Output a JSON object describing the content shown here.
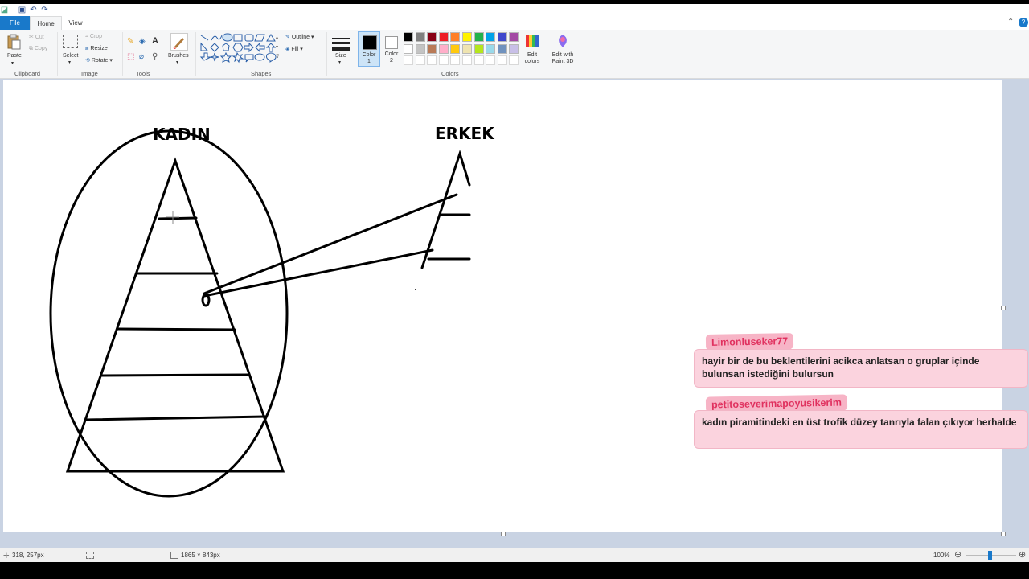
{
  "tabs": {
    "file": "File",
    "home": "Home",
    "view": "View"
  },
  "ribbon": {
    "clipboard": {
      "paste": "Paste",
      "cut": "Cut",
      "copy": "Copy",
      "label": "Clipboard"
    },
    "image": {
      "select": "Select",
      "crop": "Crop",
      "resize": "Resize",
      "rotate": "Rotate",
      "label": "Image"
    },
    "tools": {
      "label": "Tools",
      "brushes": "Brushes"
    },
    "shapes": {
      "outline": "Outline",
      "fill": "Fill",
      "label": "Shapes"
    },
    "size": {
      "label": "Size"
    },
    "colors": {
      "color1": "Color\n1",
      "color2": "Color\n2",
      "edit": "Edit\ncolors",
      "paint3d": "Edit with\nPaint 3D",
      "label": "Colors",
      "palette": [
        "#000000",
        "#7f7f7f",
        "#880015",
        "#ed1c24",
        "#ff7f27",
        "#fff200",
        "#22b14c",
        "#00a2e8",
        "#3f48cc",
        "#a349a4",
        "#ffffff",
        "#c3c3c3",
        "#b97a57",
        "#ffaec9",
        "#ffc90e",
        "#efe4b0",
        "#b5e61d",
        "#99d9ea",
        "#7092be",
        "#c8bfe7"
      ]
    }
  },
  "drawing": {
    "label_left": "KADIN",
    "label_right": "ERKEK"
  },
  "chat": [
    {
      "user": "Limonluseker77",
      "message": "hayir bir de bu beklentilerini acikca anlatsan o gruplar içinde bulunsan istediğini bulursun"
    },
    {
      "user": "petitoseverimapoyusikerim",
      "message": "kadın piramitindeki en üst trofik düzey tanrıyla falan çıkıyor herhalde"
    }
  ],
  "status": {
    "cursor": "318, 257px",
    "canvas_size": "1865 × 843px",
    "zoom": "100%"
  }
}
